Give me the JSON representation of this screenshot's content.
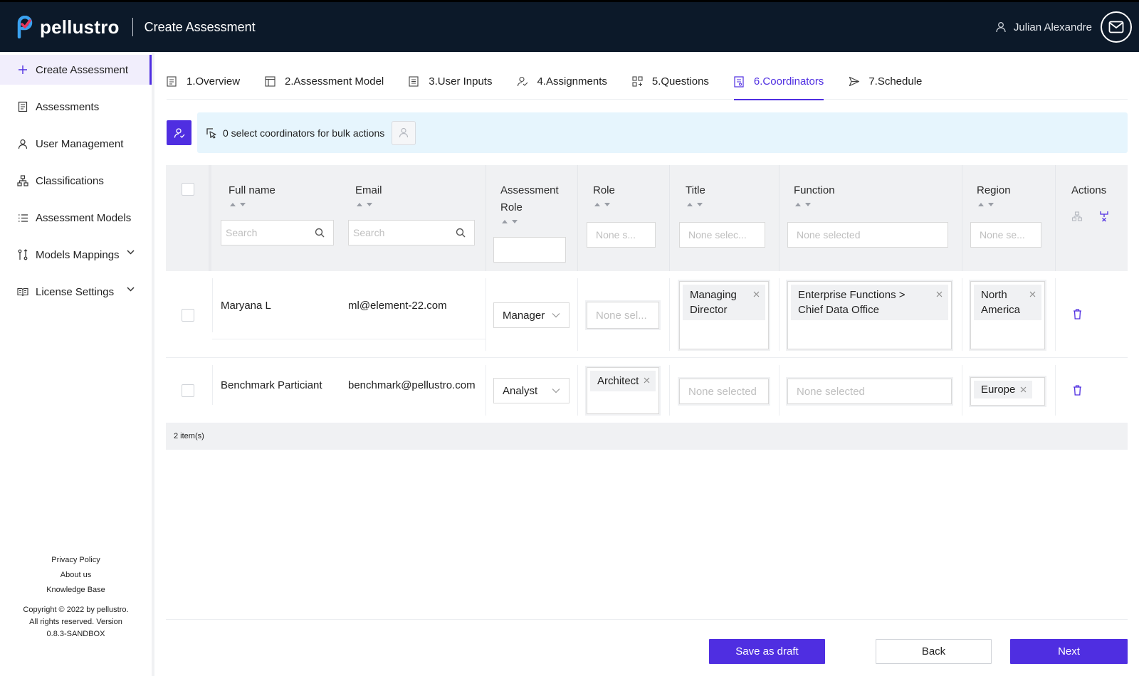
{
  "app": {
    "brand": "pellustro",
    "page_title": "Create Assessment",
    "user_name": "Julian Alexandre",
    "accent_color": "#4f2ee1",
    "header_color": "#0c1929"
  },
  "sidebar": {
    "items": [
      {
        "label": "Create Assessment",
        "icon": "plus-icon"
      },
      {
        "label": "Assessments",
        "icon": "clipboard-icon"
      },
      {
        "label": "User Management",
        "icon": "user-icon"
      },
      {
        "label": "Classifications",
        "icon": "hierarchy-icon"
      },
      {
        "label": "Assessment Models",
        "icon": "list-icon"
      },
      {
        "label": "Models Mappings",
        "icon": "mapping-icon"
      },
      {
        "label": "License Settings",
        "icon": "book-icon"
      }
    ],
    "footer": {
      "privacy": "Privacy Policy",
      "about": "About us",
      "kb": "Knowledge Base",
      "copyright": "Copyright © 2022 by pellustro. All rights reserved. Version 0.8.3-SANDBOX"
    }
  },
  "tabs": [
    {
      "label": "1.Overview"
    },
    {
      "label": "2.Assessment Model"
    },
    {
      "label": "3.User Inputs"
    },
    {
      "label": "4.Assignments"
    },
    {
      "label": "5.Questions"
    },
    {
      "label": "6.Coordinators",
      "active": true
    },
    {
      "label": "7.Schedule"
    }
  ],
  "bulk": {
    "text": "0 select coordinators for bulk actions"
  },
  "table": {
    "headers": {
      "full_name": "Full name",
      "email": "Email",
      "assessment_role_1": "Assessment",
      "assessment_role_2": "Role",
      "role": "Role",
      "title": "Title",
      "function": "Function",
      "region": "Region",
      "actions": "Actions"
    },
    "filters": {
      "search": "Search",
      "role_placeholder": "None s...",
      "title_placeholder": "None selec...",
      "function_placeholder": "None selected",
      "region_placeholder": "None se..."
    },
    "rows": [
      {
        "full_name": "Maryana L",
        "email": "ml@element-22.com",
        "assessment_role": "Manager",
        "role_placeholder": "None sel...",
        "title_tag_1": "Managing",
        "title_tag_2": "Director",
        "function_tag_1": "Enterprise Functions >",
        "function_tag_2": "Chief Data Office",
        "region_tag_1": "North",
        "region_tag_2": "America"
      },
      {
        "full_name": "Benchmark Particiant",
        "email": "benchmark@pellustro.com",
        "assessment_role": "Analyst",
        "role_tag": "Architect",
        "title_placeholder": "None selected",
        "function_placeholder": "None selected",
        "region_tag": "Europe"
      }
    ],
    "count": "2 item(s)"
  },
  "buttons": {
    "save_draft": "Save as draft",
    "back": "Back",
    "next": "Next"
  }
}
